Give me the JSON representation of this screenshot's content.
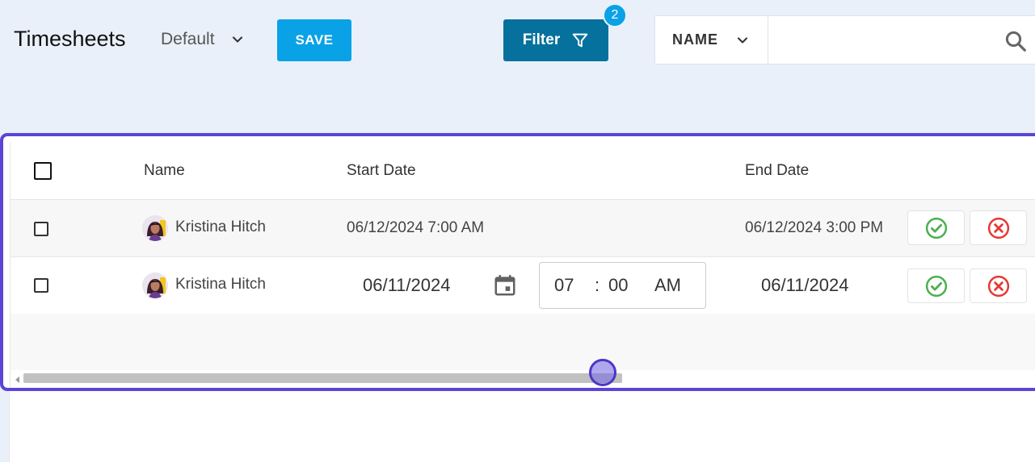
{
  "header": {
    "title": "Timesheets",
    "view_label": "Default",
    "save_label": "SAVE",
    "filter_label": "Filter",
    "filter_count": "2",
    "search_field": "NAME",
    "search_value": ""
  },
  "grid": {
    "columns": {
      "name": "Name",
      "start_date": "Start Date",
      "end_date": "End Date"
    },
    "rows": [
      {
        "name": "Kristina Hitch",
        "start": "06/12/2024 7:00 AM",
        "end": "06/12/2024 3:00 PM"
      },
      {
        "name": "Kristina Hitch",
        "start_date": "06/11/2024",
        "start_hour": "07",
        "start_sep": ":",
        "start_minute": "00",
        "start_ampm": "AM",
        "end_date": "06/11/2024"
      }
    ]
  },
  "colors": {
    "accent": "#0aa2e6",
    "filter": "#06719d",
    "focus_outline": "#5a45d8",
    "approve": "#4caf50",
    "reject": "#e53935"
  },
  "icons": {
    "view_dropdown": "chevron-down-icon",
    "filter": "filter-icon",
    "search_field_dropdown": "chevron-down-icon",
    "search": "search-icon",
    "calendar": "calendar-icon",
    "approve": "check-circle-icon",
    "reject": "x-circle-icon"
  }
}
